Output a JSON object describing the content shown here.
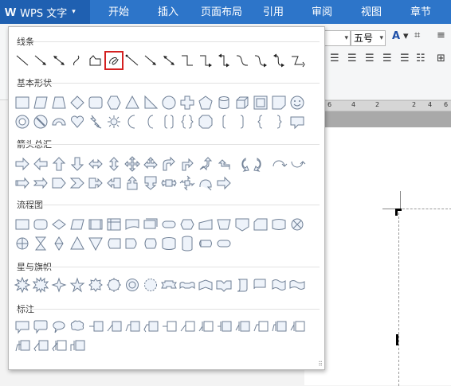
{
  "app": {
    "logo": "W",
    "title": "WPS 文字",
    "menu_caret": "▾"
  },
  "tabs": [
    "开始",
    "插入",
    "页面布局",
    "引用",
    "审阅",
    "视图",
    "章节"
  ],
  "ribbon": {
    "font_size": "五号",
    "caret": "▾",
    "font_color_letter": "A"
  },
  "ruler": {
    "ticks": [
      "6",
      "4",
      "2",
      "2",
      "4",
      "6"
    ]
  },
  "shape_panel": {
    "selected": "lines.7",
    "sections": [
      {
        "id": "lines",
        "title": "线条",
        "count": 16,
        "icons": [
          "line",
          "arrow",
          "double-arrow",
          "curve",
          "freeform",
          "scribble",
          "elbow-connector",
          "elbow-arrow-connector",
          "elbow-double-arrow-connector",
          "curved-connector",
          "curved-arrow-connector",
          "curved-double-arrow-connector",
          "s-curve",
          "s-arrow",
          "s-double-arrow",
          "zigzag"
        ]
      },
      {
        "id": "basic",
        "title": "基本形状",
        "count": 32,
        "icons": []
      },
      {
        "id": "arrows",
        "title": "箭头总汇",
        "count": 28,
        "icons": []
      },
      {
        "id": "flowchart",
        "title": "流程图",
        "count": 28,
        "icons": []
      },
      {
        "id": "stars",
        "title": "星与旗帜",
        "count": 16,
        "icons": []
      },
      {
        "id": "callouts",
        "title": "标注",
        "count": 20,
        "icons": []
      }
    ]
  }
}
